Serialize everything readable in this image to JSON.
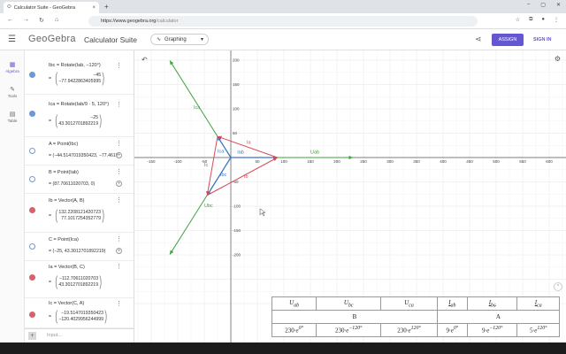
{
  "browser": {
    "tab_title": "Calculator Suite - GeoGebra",
    "tab_close": "×",
    "new_tab": "+",
    "url_host": "https://www.geogebra.org",
    "url_path": "/calculator",
    "window_controls": [
      "–",
      "▢",
      "✕"
    ]
  },
  "header": {
    "logo": "GeoGebra",
    "suite": "Calculator Suite",
    "app_select": "Graphing",
    "assign": "ASSIGN",
    "signin": "SIGN IN"
  },
  "tools": [
    {
      "label": "Algebra",
      "icon": "calculator-icon"
    },
    {
      "label": "Tools",
      "icon": "tools-icon"
    },
    {
      "label": "Table",
      "icon": "table-icon"
    }
  ],
  "algebra": {
    "rows": [
      {
        "name": "Ibc",
        "cmd": "Ibc = Rotate(Iab, −120°)",
        "vec": [
          "−45",
          "−77.9422863405995"
        ],
        "dot": "filled-blue"
      },
      {
        "name": "Ica",
        "cmd": "Ica = Rotate(Iab/9 · 5, 120°)",
        "vec": [
          "−25",
          "43.3012701892219"
        ],
        "dot": "filled-blue"
      },
      {
        "name": "A",
        "cmd": "A = Point(Ibc)",
        "val": "= (−44.5147019350423, −77.4617",
        "dot": "hollow-blue"
      },
      {
        "name": "B",
        "cmd": "B = Point(Iab)",
        "val": "= (87.7061102070​3, 0)",
        "dot": "hollow-blue"
      },
      {
        "name": "Ib",
        "cmd": "Ib = Vector(A, B)",
        "vec": [
          "132.2208121420723",
          "77.1017254352779"
        ],
        "dot": "filled-red"
      },
      {
        "name": "C",
        "cmd": "C = Point(Ica)",
        "val": "= (−25, 43.3012701892219)",
        "dot": "hollow-blue"
      },
      {
        "name": "Ia",
        "cmd": "Ia = Vector(B, C)",
        "vec": [
          "−112.706110207​03",
          "43.3012701892219"
        ],
        "dot": "filled-red"
      },
      {
        "name": "Ic",
        "cmd": "Ic = Vector(C, A)",
        "vec": [
          "−19.5147019350423",
          "−120.4029956244999"
        ],
        "dot": "filled-red"
      }
    ],
    "input_placeholder": "Input..."
  },
  "graph": {
    "x_ticks": [
      -150,
      -100,
      -50,
      50,
      100,
      150,
      200,
      250,
      300,
      350,
      400,
      450,
      500,
      550,
      600,
      650,
      700
    ],
    "y_ticks": [
      200,
      150,
      100,
      50,
      -50,
      -100,
      -150,
      -200
    ],
    "labels": {
      "Ica_top": "Ica",
      "Ia": "Ia",
      "Uab": "Uab",
      "Ica": "Ica",
      "Iab": "Iab",
      "Ic": "Ic",
      "Ibc": "Ibc",
      "Ib": "Ib",
      "Ubc": "Ubc"
    },
    "colors": {
      "green": "#3fa33f",
      "blue": "#3a73c9",
      "red": "#d44b57"
    }
  },
  "table": {
    "headers": [
      "U",
      "ab",
      "U",
      "bc",
      "U",
      "ca",
      "I",
      "ab",
      "I",
      "bc",
      "I",
      "ca"
    ],
    "header_cells": [
      {
        "main": "U",
        "sub": "ab"
      },
      {
        "main": "U",
        "sub": "bc"
      },
      {
        "main": "U",
        "sub": "ca"
      },
      {
        "main": "I",
        "sub": "ab"
      },
      {
        "main": "I",
        "sub": "bc"
      },
      {
        "main": "I",
        "sub": "ca"
      }
    ],
    "group_row": [
      "B",
      "A"
    ],
    "values": [
      {
        "mag": "230",
        "ang": "0°"
      },
      {
        "mag": "230",
        "ang": "−120°"
      },
      {
        "mag": "230",
        "ang": "120°"
      },
      {
        "mag": "9",
        "ang": "0°"
      },
      {
        "mag": "9",
        "ang": "−120°"
      },
      {
        "mag": "5",
        "ang": "120°"
      }
    ]
  }
}
